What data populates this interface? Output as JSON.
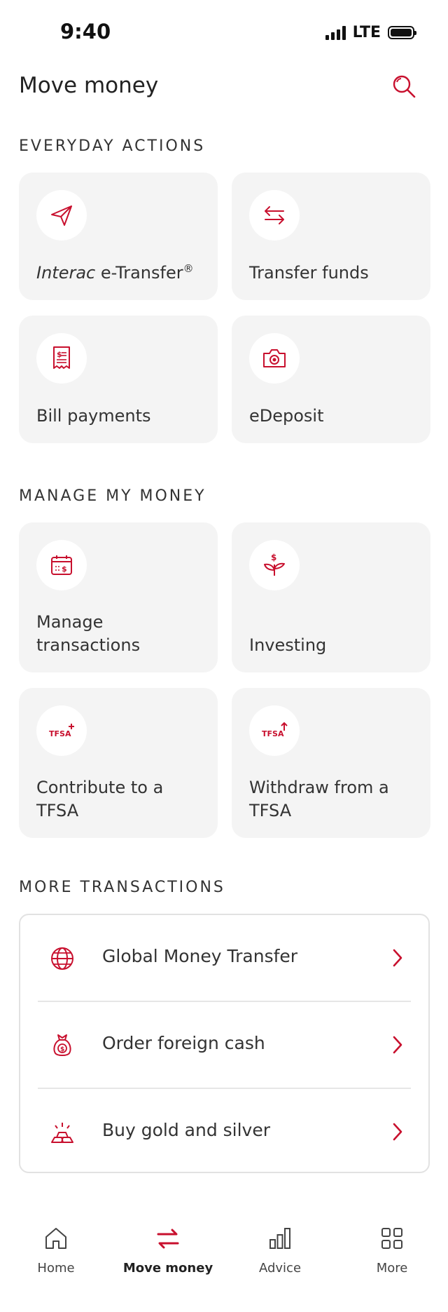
{
  "status_bar": {
    "time": "9:40",
    "network": "LTE"
  },
  "header": {
    "title": "Move money"
  },
  "sections": {
    "everyday": "EVERYDAY ACTIONS",
    "manage": "MANAGE MY MONEY",
    "more": "MORE TRANSACTIONS"
  },
  "everyday_cards": {
    "interac_brand": "Interac",
    "interac_rest": " e-Transfer",
    "interac_mark": "®",
    "transfer_funds": "Transfer funds",
    "bill_payments": "Bill payments",
    "edeposit": "eDeposit"
  },
  "manage_cards": {
    "manage_transactions": "Manage transactions",
    "investing": "Investing",
    "contribute_tfsa": "Contribute to a TFSA",
    "withdraw_tfsa": "Withdraw from a TFSA",
    "tfsa_icon_text": "TFSA",
    "investing_icon_text": "$"
  },
  "more_transactions": {
    "global_transfer": "Global Money Transfer",
    "foreign_cash": "Order foreign cash",
    "gold_silver": "Buy gold and silver"
  },
  "tab_bar": {
    "home": "Home",
    "move_money": "Move money",
    "advice": "Advice",
    "more": "More"
  },
  "colors": {
    "accent": "#c8102e",
    "card_bg": "#f4f4f4",
    "text": "#222222"
  }
}
